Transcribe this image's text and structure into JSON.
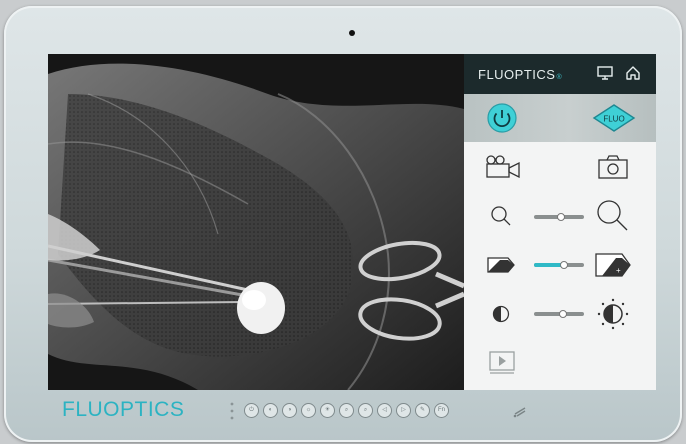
{
  "device": {
    "brand": "FLUOPTICS",
    "camera": "front-camera"
  },
  "panel": {
    "brand": "FLUOPTICS",
    "brand_mark": "®",
    "fluo_label": "FLUO"
  },
  "controls": {
    "zoom_level": 0.55,
    "brightness_level": 0.62,
    "contrast_level": 0.6
  },
  "colors": {
    "accent": "#2fb9c6",
    "header": "#1c2a2c",
    "panel": "#f3f4f4"
  },
  "icons": {
    "monitor": "monitor-icon",
    "home": "home-icon",
    "power": "power-icon",
    "fluo": "fluo-mode-icon",
    "video": "video-camera-icon",
    "photo": "photo-camera-icon",
    "zoom_out": "zoom-out-icon",
    "zoom_in": "zoom-in-icon",
    "brightness_low": "brightness-low-icon",
    "brightness_high": "brightness-high-icon",
    "contrast_low": "contrast-low-icon",
    "contrast_high": "contrast-high-icon",
    "playback": "playback-icon"
  },
  "hardware_buttons": [
    "⏻",
    "◐",
    "◑",
    "☼",
    "☀",
    "⌕",
    "⌕",
    "◁",
    "▷",
    "✎",
    "Fn"
  ]
}
